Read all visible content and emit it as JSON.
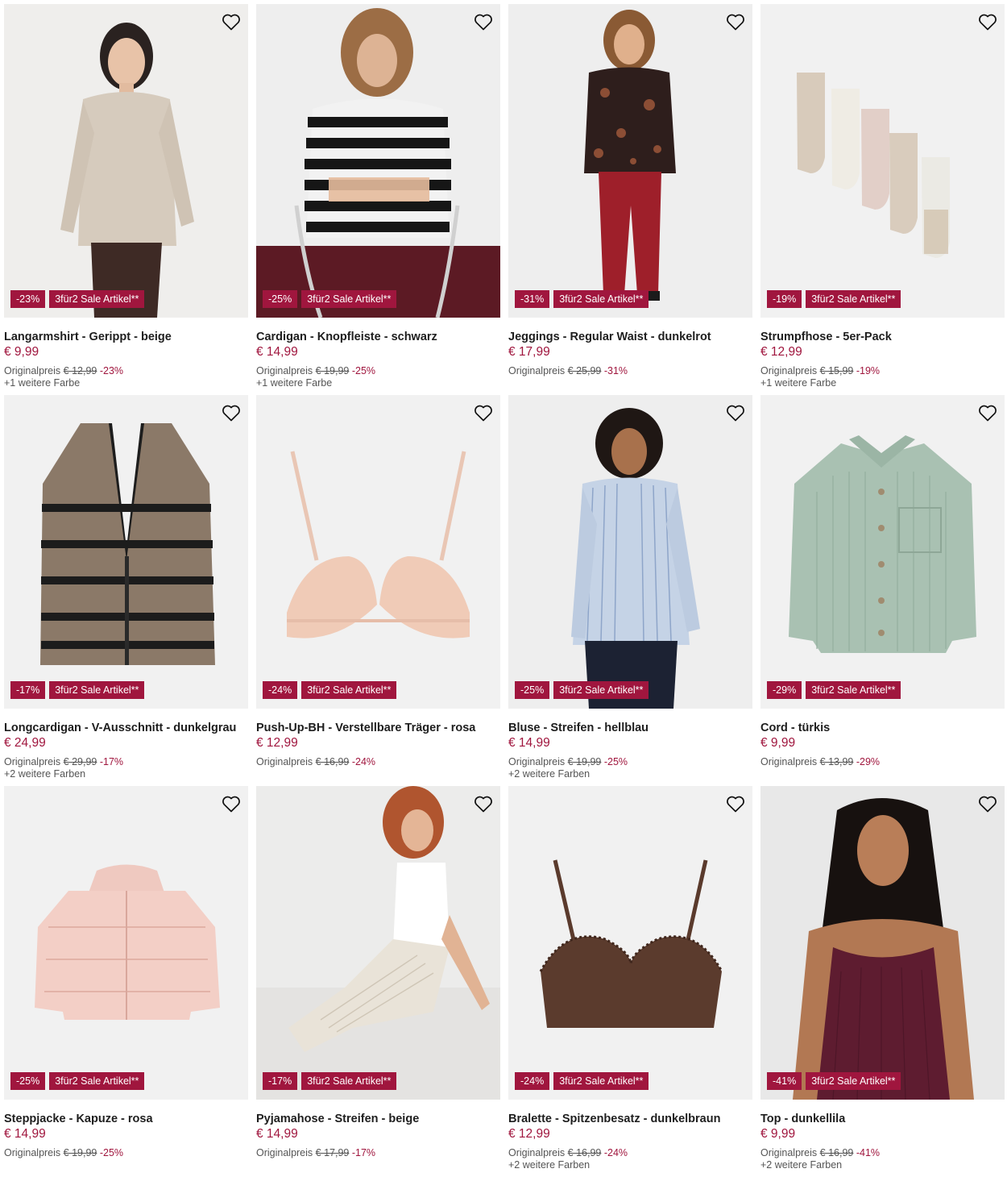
{
  "products": [
    {
      "title": "Langarmshirt - Gerippt - beige",
      "price": "€ 9,99",
      "orig_label": "Originalpreis",
      "orig_price": "€ 12,99",
      "orig_pct": "-23%",
      "discount": "-23%",
      "promo": "3für2 Sale Artikel**",
      "colors": "+1 weitere Farbe",
      "bg": "#efeeec",
      "icon": "long-sleeve-shirt-model"
    },
    {
      "title": "Cardigan - Knopfleiste - schwarz",
      "price": "€ 14,99",
      "orig_label": "Originalpreis",
      "orig_price": "€ 19,99",
      "orig_pct": "-25%",
      "discount": "-25%",
      "promo": "3für2 Sale Artikel**",
      "colors": "+1 weitere Farbe",
      "bg": "#eeeeee",
      "icon": "striped-cardigan-model"
    },
    {
      "title": "Jeggings - Regular Waist - dunkelrot",
      "price": "€ 17,99",
      "orig_label": "Originalpreis",
      "orig_price": "€ 25,99",
      "orig_pct": "-31%",
      "discount": "-31%",
      "promo": "3für2 Sale Artikel**",
      "colors": "",
      "bg": "#eeeeee",
      "icon": "jeggings-model"
    },
    {
      "title": "Strumpfhose - 5er-Pack",
      "price": "€ 12,99",
      "orig_label": "Originalpreis",
      "orig_price": "€ 15,99",
      "orig_pct": "-19%",
      "discount": "-19%",
      "promo": "3für2 Sale Artikel**",
      "colors": "+1 weitere Farbe",
      "bg": "#f1f1f1",
      "icon": "tights-pack"
    },
    {
      "title": "Longcardigan - V-Ausschnitt - dunkelgrau",
      "price": "€ 24,99",
      "orig_label": "Originalpreis",
      "orig_price": "€ 29,99",
      "orig_pct": "-17%",
      "discount": "-17%",
      "promo": "3für2 Sale Artikel**",
      "colors": "+2 weitere Farben",
      "bg": "#f1f1f1",
      "icon": "long-cardigan"
    },
    {
      "title": "Push-Up-BH - Verstellbare Träger - rosa",
      "price": "€ 12,99",
      "orig_label": "Originalpreis",
      "orig_price": "€ 16,99",
      "orig_pct": "-24%",
      "discount": "-24%",
      "promo": "3für2 Sale Artikel**",
      "colors": "",
      "bg": "#f1f1f1",
      "icon": "push-up-bra"
    },
    {
      "title": "Bluse - Streifen - hellblau",
      "price": "€ 14,99",
      "orig_label": "Originalpreis",
      "orig_price": "€ 19,99",
      "orig_pct": "-25%",
      "discount": "-25%",
      "promo": "3für2 Sale Artikel**",
      "colors": "+2 weitere Farben",
      "bg": "#eeeeee",
      "icon": "striped-blouse-model"
    },
    {
      "title": "Cord - türkis",
      "price": "€ 9,99",
      "orig_label": "Originalpreis",
      "orig_price": "€ 13,99",
      "orig_pct": "-29%",
      "discount": "-29%",
      "promo": "3für2 Sale Artikel**",
      "colors": "",
      "bg": "#f1f1f1",
      "icon": "corduroy-shirt"
    },
    {
      "title": "Steppjacke - Kapuze - rosa",
      "price": "€ 14,99",
      "orig_label": "Originalpreis",
      "orig_price": "€ 19,99",
      "orig_pct": "-25%",
      "discount": "-25%",
      "promo": "3für2 Sale Artikel**",
      "colors": "",
      "bg": "#f1f1f1",
      "icon": "puffer-jacket"
    },
    {
      "title": "Pyjamahose - Streifen - beige",
      "price": "€ 14,99",
      "orig_label": "Originalpreis",
      "orig_price": "€ 17,99",
      "orig_pct": "-17%",
      "discount": "-17%",
      "promo": "3für2 Sale Artikel**",
      "colors": "",
      "bg": "#ececeb",
      "icon": "pyjama-pants-model"
    },
    {
      "title": "Bralette - Spitzenbesatz - dunkelbraun",
      "price": "€ 12,99",
      "orig_label": "Originalpreis",
      "orig_price": "€ 16,99",
      "orig_pct": "-24%",
      "discount": "-24%",
      "promo": "3für2 Sale Artikel**",
      "colors": "+2 weitere Farben",
      "bg": "#f1f1f1",
      "icon": "bralette"
    },
    {
      "title": "Top - dunkellila",
      "price": "€ 9,99",
      "orig_label": "Originalpreis",
      "orig_price": "€ 16,99",
      "orig_pct": "-41%",
      "discount": "-41%",
      "promo": "3für2 Sale Artikel**",
      "colors": "+2 weitere Farben",
      "bg": "#e8e8e8",
      "icon": "tank-top-model"
    }
  ],
  "colors": {
    "accent": "#a0163e",
    "text": "#1e1e1e",
    "muted": "#555555"
  }
}
